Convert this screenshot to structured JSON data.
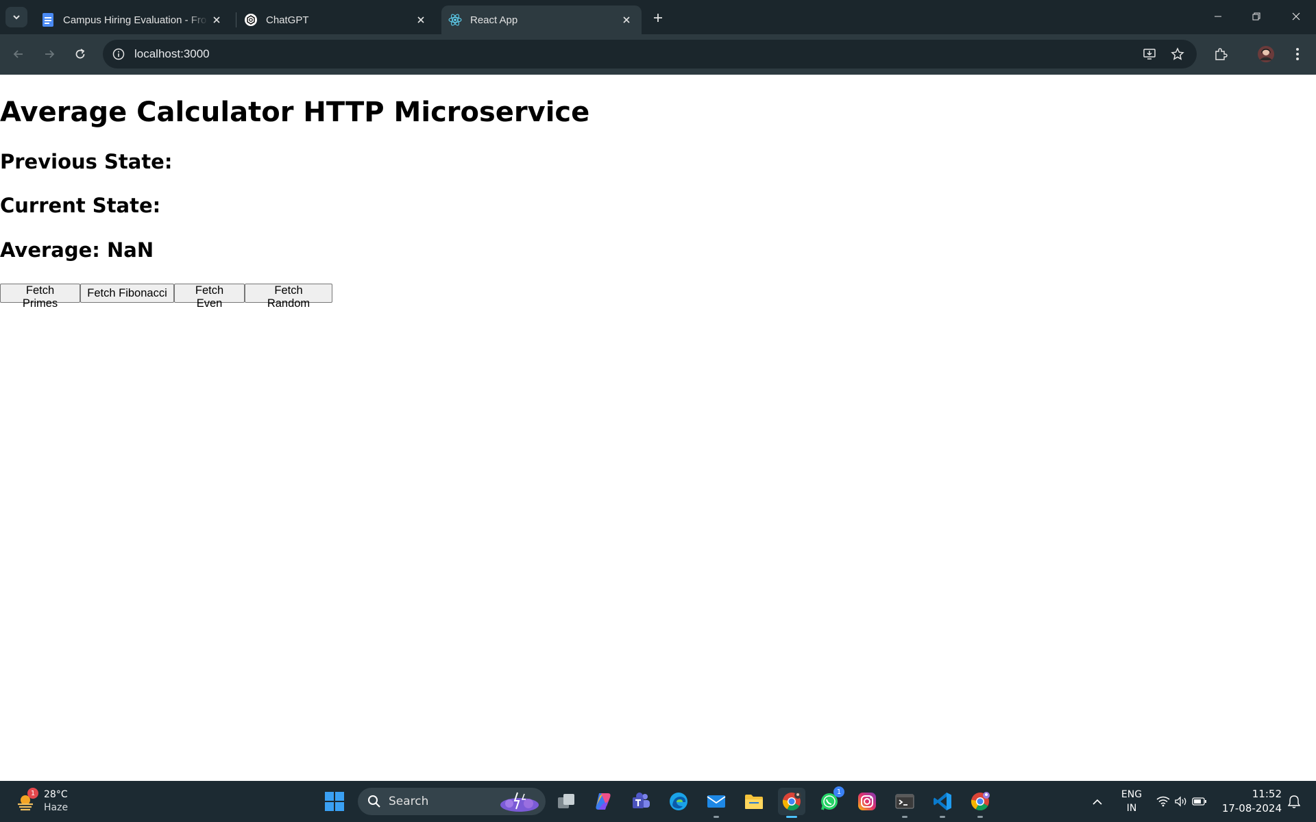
{
  "browser": {
    "tabs": [
      {
        "title": "Campus Hiring Evaluation - Fro",
        "icon": "google-docs-icon",
        "active": false
      },
      {
        "title": "ChatGPT",
        "icon": "chatgpt-icon",
        "active": false
      },
      {
        "title": "React App",
        "icon": "react-icon",
        "active": true
      }
    ],
    "url": "localhost:3000"
  },
  "page": {
    "title": "Average Calculator HTTP Microservice",
    "previous_state_label": "Previous State:",
    "current_state_label": "Current State:",
    "average_label": "Average: NaN",
    "buttons": [
      "Fetch Primes",
      "Fetch Fibonacci",
      "Fetch Even",
      "Fetch Random"
    ]
  },
  "taskbar": {
    "weather": {
      "temp": "28°C",
      "condition": "Haze",
      "badge": "1"
    },
    "search_placeholder": "Search",
    "whatsapp_badge": "1",
    "language": {
      "line1": "ENG",
      "line2": "IN"
    },
    "time": "11:52",
    "date": "17-08-2024"
  },
  "colors": {
    "accent": "#4cc2ff",
    "chrome_dark": "#1b262c",
    "chrome_toolbar": "#2d3a40"
  }
}
